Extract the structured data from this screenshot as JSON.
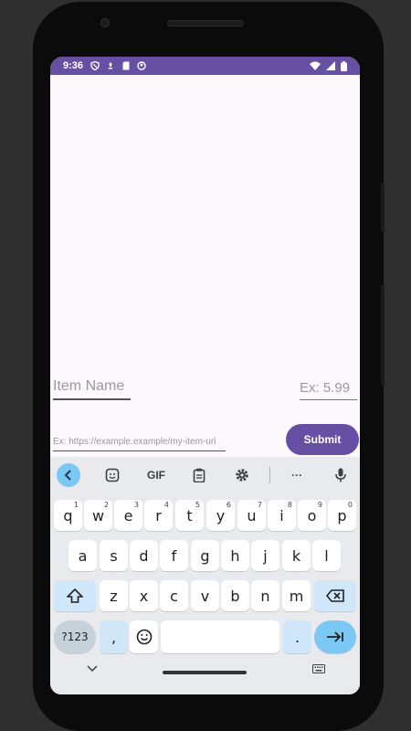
{
  "status_bar": {
    "time": "9:36",
    "color": "#6750a4"
  },
  "form": {
    "item_name_placeholder": "Item Name",
    "price_placeholder": "Ex: 5.99",
    "url_placeholder": "Ex: https://example.example/my-item-url",
    "submit_label": "Submit"
  },
  "keyboard": {
    "toolbar": {
      "gif_label": "GIF",
      "more_label": "···"
    },
    "row1": [
      {
        "key": "q",
        "hint": "1"
      },
      {
        "key": "w",
        "hint": "2"
      },
      {
        "key": "e",
        "hint": "3"
      },
      {
        "key": "r",
        "hint": "4"
      },
      {
        "key": "t",
        "hint": "5"
      },
      {
        "key": "y",
        "hint": "6"
      },
      {
        "key": "u",
        "hint": "7"
      },
      {
        "key": "i",
        "hint": "8"
      },
      {
        "key": "o",
        "hint": "9"
      },
      {
        "key": "p",
        "hint": "0"
      }
    ],
    "row2": [
      "a",
      "s",
      "d",
      "f",
      "g",
      "h",
      "j",
      "k",
      "l"
    ],
    "row3": [
      "z",
      "x",
      "c",
      "v",
      "b",
      "n",
      "m"
    ],
    "symbols_label": "?123",
    "comma_label": ",",
    "period_label": "."
  },
  "colors": {
    "accent": "#6750a4",
    "key_action": "#7cc8f5"
  }
}
